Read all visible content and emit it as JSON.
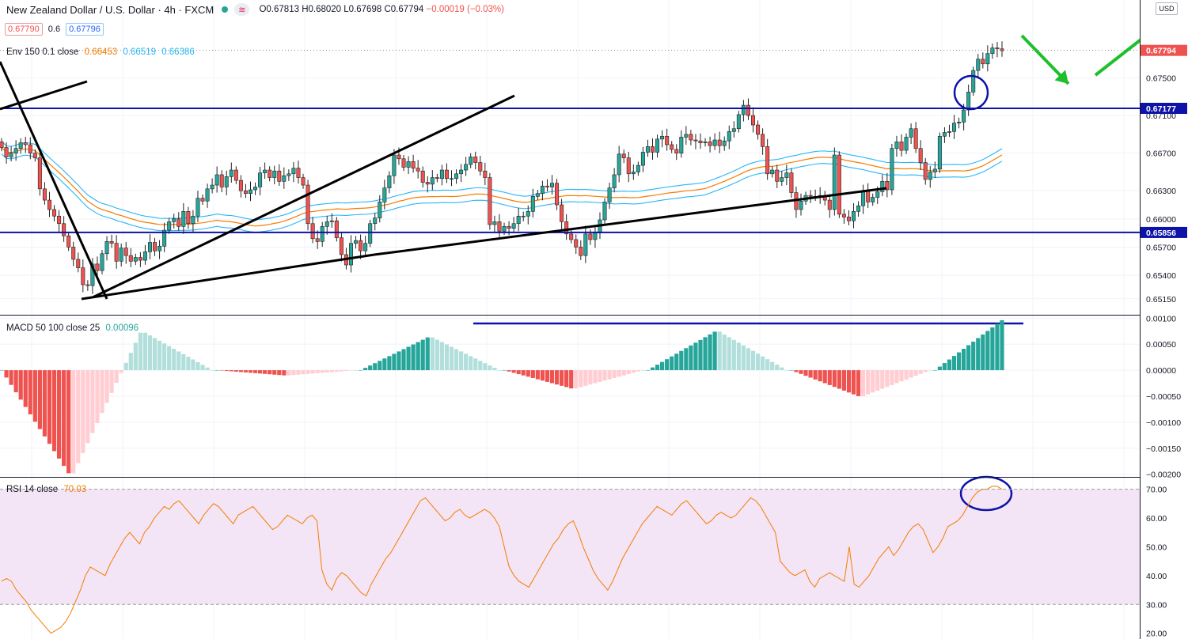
{
  "header": {
    "symbol": "New Zealand Dollar / U.S. Dollar · 4h · FXCM",
    "open": "O0.67813",
    "high": "H0.68020",
    "low": "L0.67698",
    "close": "C0.67794",
    "change": "−0.00019 (−0.03%)",
    "sell_price": "0.67790",
    "spread": "0.6",
    "buy_price": "0.67796",
    "currency": "USD"
  },
  "envelope_legend": {
    "name": "Env 150 0.1 close",
    "v1": "0.66453",
    "v2": "0.66519",
    "v3": "0.66386"
  },
  "macd_legend": {
    "name": "MACD 50 100 close 25",
    "value": "0.00096"
  },
  "rsi_legend": {
    "name": "RSI 14 close",
    "value": "70.03"
  },
  "colors": {
    "up": "#26a69a",
    "down": "#ef5350",
    "trend": "#000000",
    "level": "#0d12a8",
    "arrow": "#1fbf2b",
    "env_mid": "#f57c00",
    "env_band": "#29b6f6",
    "rsi_line": "#f57c00",
    "rsi_band": "#f3e5f5"
  },
  "chart_data": [
    {
      "type": "candlestick",
      "title": "New Zealand Dollar / U.S. Dollar · 4h · FXCM",
      "ylim": [
        0.6498,
        0.6833
      ],
      "yticks": [
        "0.67500",
        "0.67100",
        "0.66700",
        "0.66300",
        "0.66000",
        "0.65700",
        "0.65400",
        "0.65150"
      ],
      "ytick_values": [
        0.675,
        0.671,
        0.667,
        0.663,
        0.66,
        0.657,
        0.654,
        0.6515
      ],
      "price_labels": [
        {
          "text": "0.67794",
          "value": 0.67794,
          "color": "#ef5350"
        },
        {
          "text": "0.67177",
          "value": 0.67177,
          "color": "#0d12a8"
        },
        {
          "text": "0.65856",
          "value": 0.65856,
          "color": "#0d12a8"
        }
      ],
      "horizontal_levels": [
        0.67177,
        0.65856
      ],
      "closes": [
        0.6676,
        0.6666,
        0.667,
        0.6675,
        0.6681,
        0.6679,
        0.667,
        0.6665,
        0.6632,
        0.662,
        0.661,
        0.6603,
        0.6595,
        0.6582,
        0.657,
        0.6557,
        0.6548,
        0.653,
        0.6529,
        0.6552,
        0.6545,
        0.6563,
        0.6576,
        0.6574,
        0.6555,
        0.6569,
        0.6561,
        0.6555,
        0.6559,
        0.6556,
        0.6565,
        0.6575,
        0.6566,
        0.6571,
        0.6588,
        0.6597,
        0.66,
        0.6592,
        0.6608,
        0.6595,
        0.6603,
        0.6622,
        0.6619,
        0.6632,
        0.6636,
        0.6647,
        0.6634,
        0.6645,
        0.6652,
        0.6641,
        0.663,
        0.6627,
        0.6631,
        0.6634,
        0.6649,
        0.6652,
        0.6644,
        0.6651,
        0.664,
        0.6646,
        0.6648,
        0.6654,
        0.6644,
        0.6636,
        0.6595,
        0.6579,
        0.6576,
        0.6592,
        0.6597,
        0.6598,
        0.658,
        0.6562,
        0.6551,
        0.6574,
        0.6577,
        0.6566,
        0.6574,
        0.6595,
        0.6601,
        0.6618,
        0.6633,
        0.6646,
        0.6668,
        0.6664,
        0.6655,
        0.6661,
        0.6654,
        0.6651,
        0.6639,
        0.6637,
        0.6644,
        0.6643,
        0.6652,
        0.6643,
        0.6643,
        0.6648,
        0.6652,
        0.6658,
        0.6666,
        0.666,
        0.6651,
        0.6644,
        0.6594,
        0.6597,
        0.6587,
        0.6592,
        0.659,
        0.6595,
        0.6603,
        0.6603,
        0.6608,
        0.6624,
        0.6627,
        0.6635,
        0.6634,
        0.6638,
        0.6615,
        0.6597,
        0.6584,
        0.6578,
        0.657,
        0.6561,
        0.6584,
        0.6578,
        0.6585,
        0.6599,
        0.6618,
        0.6633,
        0.6647,
        0.6669,
        0.6665,
        0.6648,
        0.665,
        0.6657,
        0.6671,
        0.6677,
        0.6671,
        0.6685,
        0.6688,
        0.6679,
        0.6674,
        0.667,
        0.6687,
        0.669,
        0.6684,
        0.6683,
        0.6681,
        0.6682,
        0.6678,
        0.6684,
        0.6678,
        0.6683,
        0.6693,
        0.6696,
        0.6711,
        0.6721,
        0.671,
        0.67,
        0.669,
        0.6677,
        0.6648,
        0.6652,
        0.664,
        0.6644,
        0.6649,
        0.6628,
        0.661,
        0.6619,
        0.6625,
        0.6624,
        0.6624,
        0.6625,
        0.662,
        0.661,
        0.6668,
        0.6605,
        0.6602,
        0.6598,
        0.6608,
        0.6614,
        0.663,
        0.6618,
        0.6623,
        0.6629,
        0.664,
        0.6631,
        0.6675,
        0.6682,
        0.6673,
        0.6687,
        0.6696,
        0.6675,
        0.666,
        0.6642,
        0.665,
        0.6653,
        0.6688,
        0.6692,
        0.6693,
        0.6702,
        0.6703,
        0.6716,
        0.6735,
        0.6758,
        0.677,
        0.6765,
        0.6776,
        0.6782,
        0.6781,
        0.6779
      ]
    },
    {
      "type": "bar",
      "title": "MACD 50 100 close 25",
      "ylim": [
        -0.00205,
        0.00105
      ],
      "yticks": [
        "0.00100",
        "0.00050",
        "0.00000",
        "−0.00050",
        "−0.00100",
        "−0.00150",
        "−0.00200"
      ],
      "ytick_values": [
        0.001,
        0.0005,
        0,
        -0.0005,
        -0.001,
        -0.0015,
        -0.002
      ],
      "segments": [
        {
          "from": 0.0,
          "to": -0.00198
        },
        {
          "from": -0.00198,
          "to": 0.00072
        },
        {
          "from": 0.00072,
          "to": 0.0
        },
        {
          "from": 0.0,
          "to": -0.0001
        },
        {
          "from": -0.0001,
          "to": 0.0
        },
        {
          "from": 0.0,
          "to": 0.00063
        },
        {
          "from": 0.00063,
          "to": 0.0
        },
        {
          "from": 0.0,
          "to": -0.00035
        },
        {
          "from": -0.00035,
          "to": 0.0
        },
        {
          "from": 0.0,
          "to": 0.00074
        },
        {
          "from": 0.00074,
          "to": 0.0
        },
        {
          "from": 0.0,
          "to": -0.0005
        },
        {
          "from": -0.0005,
          "to": 0.0
        },
        {
          "from": 0.0,
          "to": 0.00096
        }
      ],
      "value": 0.00096
    },
    {
      "type": "line",
      "title": "RSI 14 close",
      "ylim": [
        18,
        74
      ],
      "yticks": [
        "70.00",
        "60.00",
        "50.00",
        "40.00",
        "30.00",
        "20.00"
      ],
      "ytick_values": [
        70,
        60,
        50,
        40,
        30,
        20
      ],
      "band": [
        30,
        70
      ],
      "value": 70.03,
      "values": [
        38,
        39,
        38,
        35,
        33,
        31,
        28,
        26,
        24,
        22,
        20,
        21,
        22,
        24,
        27,
        31,
        35,
        40,
        43,
        42,
        41,
        40,
        44,
        47,
        50,
        53,
        55,
        53,
        51,
        55,
        57,
        60,
        62,
        64,
        63,
        65,
        66,
        64,
        62,
        60,
        58,
        61,
        63,
        65,
        64,
        62,
        60,
        58,
        61,
        62,
        63,
        64,
        62,
        60,
        58,
        56,
        57,
        59,
        61,
        60,
        59,
        58,
        60,
        61,
        59,
        42,
        37,
        35,
        39,
        41,
        40,
        38,
        36,
        34,
        33,
        37,
        40,
        43,
        46,
        48,
        51,
        54,
        57,
        60,
        63,
        66,
        67,
        65,
        63,
        61,
        59,
        60,
        62,
        63,
        61,
        60,
        61,
        62,
        63,
        62,
        60,
        57,
        50,
        43,
        40,
        38,
        37,
        36,
        39,
        42,
        45,
        48,
        51,
        53,
        56,
        58,
        59,
        55,
        50,
        46,
        42,
        39,
        37,
        35,
        38,
        42,
        46,
        49,
        52,
        55,
        58,
        60,
        62,
        64,
        63,
        62,
        61,
        63,
        65,
        66,
        64,
        62,
        60,
        58,
        59,
        61,
        62,
        61,
        60,
        61,
        63,
        65,
        67,
        66,
        64,
        61,
        58,
        55,
        45,
        43,
        41,
        40,
        41,
        42,
        38,
        36,
        39,
        40,
        41,
        40,
        39,
        38,
        50,
        37,
        36,
        38,
        40,
        43,
        46,
        48,
        50,
        47,
        49,
        52,
        55,
        57,
        58,
        56,
        52,
        48,
        50,
        53,
        57,
        58,
        59,
        61,
        64,
        67,
        69,
        70,
        70,
        71,
        71,
        70
      ]
    }
  ]
}
